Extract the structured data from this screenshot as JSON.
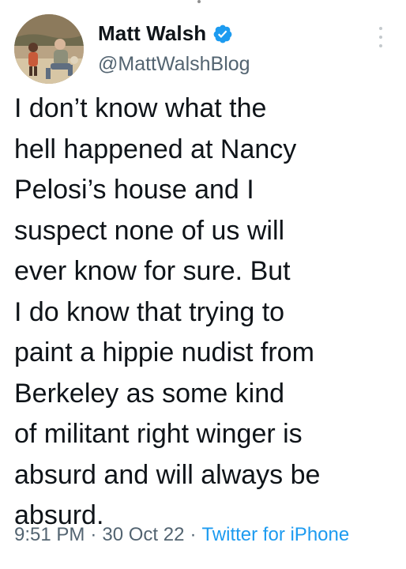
{
  "tweet": {
    "display_name": "Matt Walsh",
    "handle": "@MattWalshBlog",
    "verified": true,
    "text": "I don’t know what the\nhell happened at Nancy\nPelosi’s house and I\nsuspect none of us will\never know for sure. But\nI do know that trying to\npaint a hippie nudist from\nBerkeley as some kind\nof militant right winger is\nabsurd and will always be\nabsurd.",
    "time": "9:51 PM",
    "separator": "·",
    "date": "30 Oct 22",
    "source": "Twitter for iPhone"
  },
  "icons": {
    "verified": "verified-badge-icon",
    "more": "more-options-icon"
  },
  "colors": {
    "text": "#0f1419",
    "secondary": "#536471",
    "accent": "#1d9bf0",
    "verified_badge": "#1d9bf0"
  }
}
